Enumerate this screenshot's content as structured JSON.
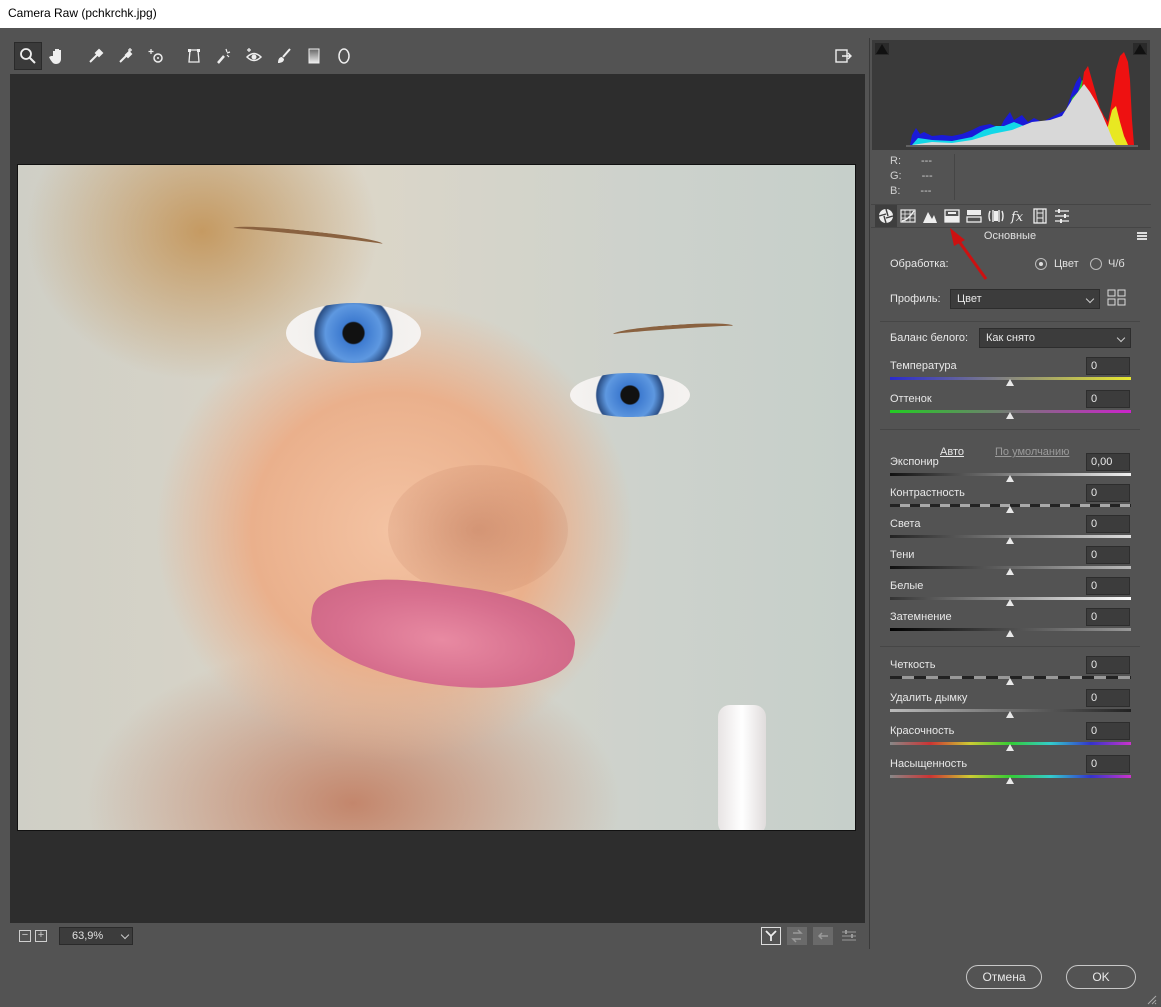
{
  "window": {
    "title": "Camera Raw (pchkrchk.jpg)"
  },
  "toolbar": {
    "tools": [
      "zoom-icon",
      "hand-icon",
      "white-balance-icon",
      "color-sampler-icon",
      "targeted-adjustment-icon",
      "transform-icon",
      "spot-removal-icon",
      "red-eye-icon",
      "adjustment-brush-icon",
      "graduated-filter-icon",
      "radial-filter-icon"
    ],
    "export_icon": "open-preferences-icon"
  },
  "status": {
    "zoom_out": "−",
    "zoom_in": "+",
    "zoom_value": "63,9%"
  },
  "histogram": {
    "r_label": "R:",
    "g_label": "G:",
    "b_label": "B:",
    "r_value": "---",
    "g_value": "---",
    "b_value": "---"
  },
  "panel": {
    "section_title": "Основные",
    "treatment_label": "Обработка:",
    "treatment_color": "Цвет",
    "treatment_bw": "Ч/б",
    "profile_label": "Профиль:",
    "profile_value": "Цвет",
    "wb_label": "Баланс белого:",
    "wb_value": "Как снято",
    "auto_link": "Авто",
    "default_link": "По умолчанию",
    "sliders": {
      "temperature": {
        "label": "Температура",
        "value": "0"
      },
      "tint": {
        "label": "Оттенок",
        "value": "0"
      },
      "exposure": {
        "label": "Экспонир",
        "value": "0,00"
      },
      "contrast": {
        "label": "Контрастность",
        "value": "0"
      },
      "highlights": {
        "label": "Света",
        "value": "0"
      },
      "shadows": {
        "label": "Тени",
        "value": "0"
      },
      "whites": {
        "label": "Белые",
        "value": "0"
      },
      "blacks": {
        "label": "Затемнение",
        "value": "0"
      },
      "clarity": {
        "label": "Четкость",
        "value": "0"
      },
      "dehaze": {
        "label": "Удалить дымку",
        "value": "0"
      },
      "vibrance": {
        "label": "Красочность",
        "value": "0"
      },
      "saturation": {
        "label": "Насыщенность",
        "value": "0"
      }
    }
  },
  "buttons": {
    "cancel": "Отмена",
    "ok": "OK"
  },
  "colors": {
    "background": "#535353",
    "canvas": "#2d2d2d",
    "histogram_bg": "#3a3a3a",
    "annotation_arrow": "#cc1111"
  }
}
